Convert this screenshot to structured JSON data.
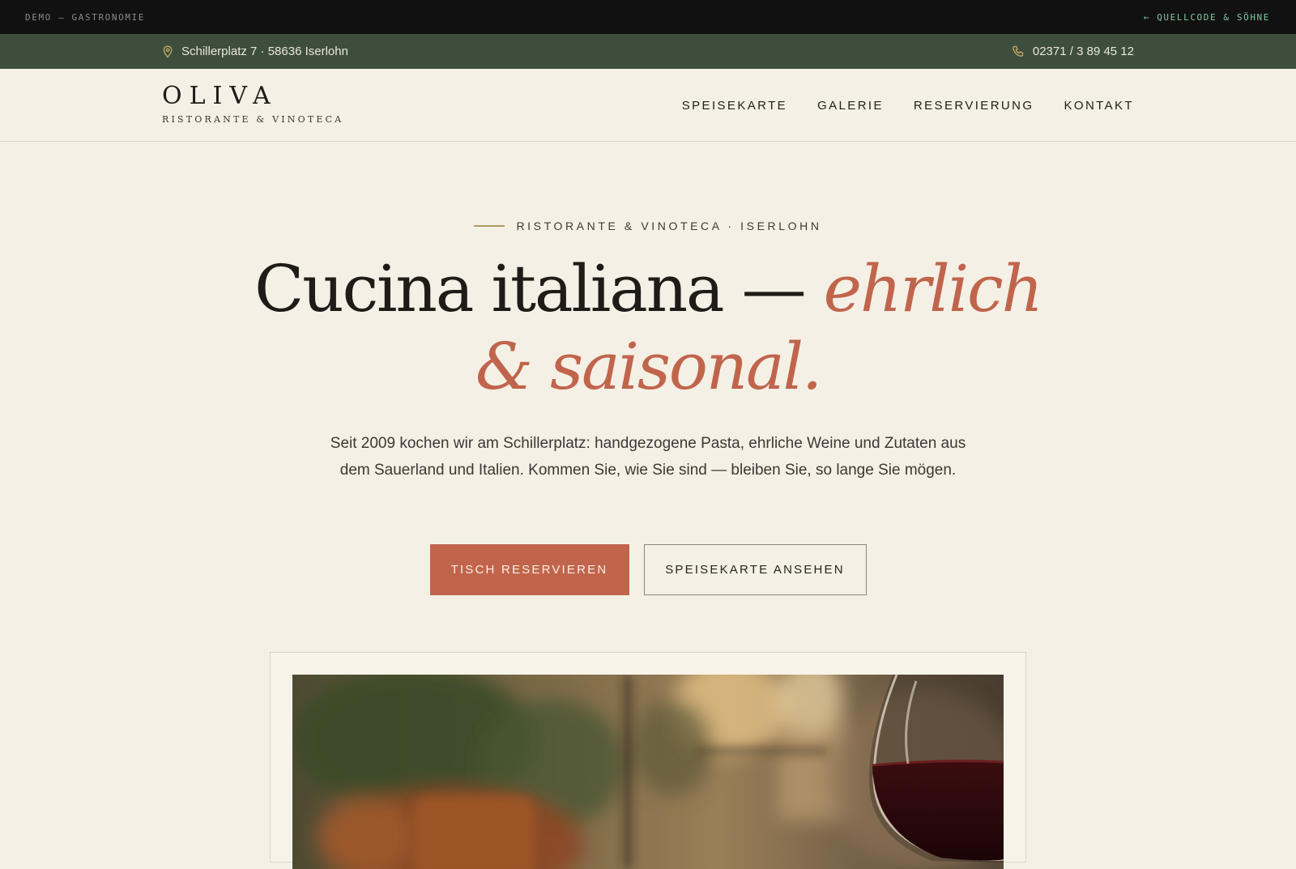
{
  "demo_bar": {
    "label": "DEMO — GASTRONOMIE",
    "source_link": "← QUELLCODE & SÖHNE"
  },
  "info_bar": {
    "address": "Schillerplatz 7 · 58636 Iserlohn",
    "address_icon": "map-pin-icon",
    "phone": "02371 / 3 89 45 12",
    "phone_icon": "phone-icon"
  },
  "header": {
    "brand_name": "OLIVA",
    "brand_sub": "RISTORANTE & VINOTECA",
    "nav": [
      {
        "label": "SPEISEKARTE"
      },
      {
        "label": "GALERIE"
      },
      {
        "label": "RESERVIERUNG"
      },
      {
        "label": "KONTAKT"
      }
    ]
  },
  "hero": {
    "eyebrow": "RISTORANTE & VINOTECA · ISERLOHN",
    "headline_main": "Cucina italiana — ",
    "headline_accent_1": "ehrlich",
    "headline_accent_2": "& saisonal.",
    "lede": "Seit 2009 kochen wir am Schillerplatz: handgezogene Pasta, ehrliche Weine und Zutaten aus dem Sauerland und Italien. Kommen Sie, wie Sie sind — bleiben Sie, so lange Sie mögen.",
    "primary_cta": "TISCH RESERVIEREN",
    "secondary_cta": "SPEISEKARTE ANSEHEN"
  },
  "colors": {
    "background": "#f4f0e6",
    "demo_bar": "#111111",
    "info_bar": "#3d4f3c",
    "accent_terracotta": "#c0654c",
    "eyebrow_gold": "#b09a5e",
    "demo_link_green": "#7fc7a3"
  }
}
